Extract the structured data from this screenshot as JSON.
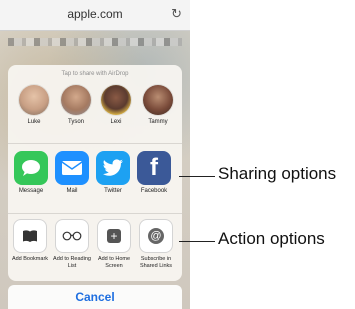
{
  "browser": {
    "url": "apple.com",
    "reload_icon": "reload-icon"
  },
  "share_sheet": {
    "airdrop_title": "Tap to share with AirDrop",
    "contacts": [
      {
        "name": "Luke",
        "color": "#c89f84"
      },
      {
        "name": "Tyson",
        "color": "#a57a61"
      },
      {
        "name": "Lexi",
        "color": "#5b3b2f"
      },
      {
        "name": "Tammy",
        "color": "#7a4b3a"
      }
    ],
    "apps": [
      {
        "label": "Message",
        "icon": "message-icon",
        "color": "#35c759"
      },
      {
        "label": "Mail",
        "icon": "mail-icon",
        "color": "#1e90ff"
      },
      {
        "label": "Twitter",
        "icon": "twitter-icon",
        "color": "#1da1f2"
      },
      {
        "label": "Facebook",
        "icon": "facebook-icon",
        "color": "#3b5998"
      }
    ],
    "actions": [
      {
        "label": "Add Bookmark",
        "icon": "book-icon"
      },
      {
        "label": "Add to Reading List",
        "icon": "glasses-icon"
      },
      {
        "label": "Add to Home Screen",
        "icon": "plus-icon"
      },
      {
        "label": "Subscribe in Shared Links",
        "icon": "at-icon"
      }
    ],
    "cancel_label": "Cancel"
  },
  "annotations": {
    "sharing_options": "Sharing options",
    "action_options": "Action options"
  }
}
